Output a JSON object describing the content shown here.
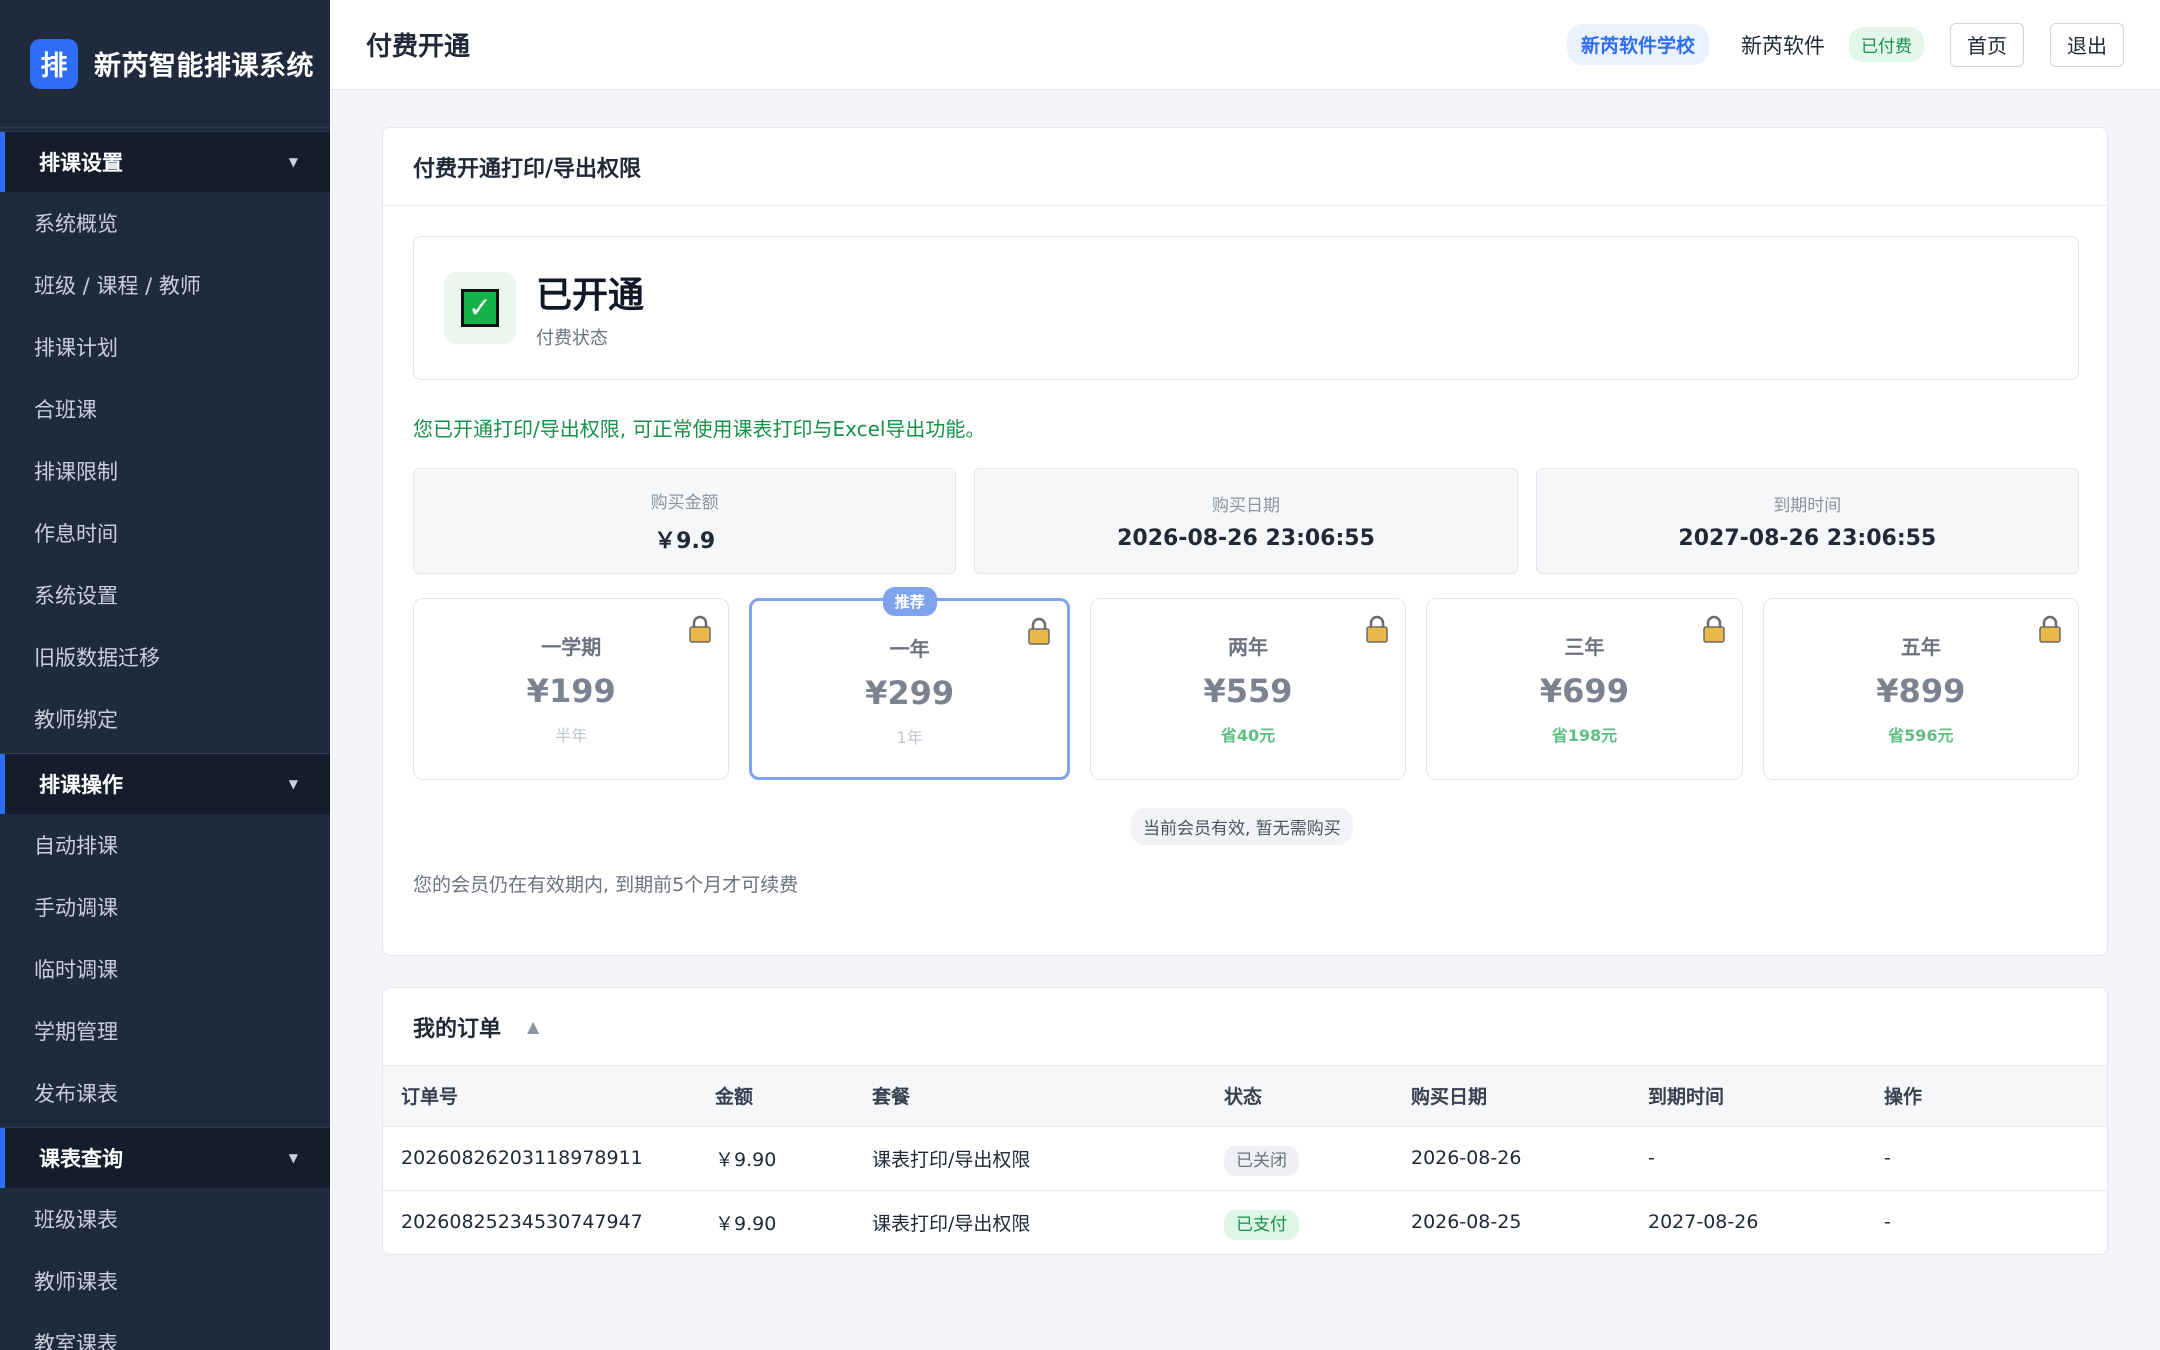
{
  "brand": {
    "logo_char": "排",
    "name": "新芮智能排课系统"
  },
  "sidebar": {
    "groups": [
      {
        "title": "排课设置",
        "items": [
          "系统概览",
          "班级 / 课程 / 教师",
          "排课计划",
          "合班课",
          "排课限制",
          "作息时间",
          "系统设置",
          "旧版数据迁移",
          "教师绑定"
        ]
      },
      {
        "title": "排课操作",
        "items": [
          "自动排课",
          "手动调课",
          "临时调课",
          "学期管理",
          "发布课表"
        ]
      },
      {
        "title": "课表查询",
        "items": [
          "班级课表",
          "教师课表",
          "教室课表"
        ]
      }
    ],
    "caret": "▼"
  },
  "header": {
    "title": "付费开通",
    "school": "新芮软件学校",
    "user": "新芮软件",
    "paid_badge": "已付费",
    "home_btn": "首页",
    "logout_btn": "退出"
  },
  "payment": {
    "card_title": "付费开通打印/导出权限",
    "status_main": "已开通",
    "status_sub": "付费状态",
    "status_check": "✓",
    "notice": "您已开通打印/导出权限, 可正常使用课表打印与Excel导出功能。",
    "info": [
      {
        "label": "购买金额",
        "value": "￥9.9"
      },
      {
        "label": "购买日期",
        "value": "2026-08-26 23:06:55"
      },
      {
        "label": "到期时间",
        "value": "2027-08-26 23:06:55"
      }
    ],
    "plans": [
      {
        "name": "一学期",
        "price": "¥199",
        "note": "半年",
        "save": false,
        "featured": false
      },
      {
        "name": "一年",
        "price": "¥299",
        "note": "1年",
        "save": false,
        "featured": true,
        "badge": "推荐"
      },
      {
        "name": "两年",
        "price": "¥559",
        "note": "省40元",
        "save": true,
        "featured": false
      },
      {
        "name": "三年",
        "price": "¥699",
        "note": "省198元",
        "save": true,
        "featured": false
      },
      {
        "name": "五年",
        "price": "¥899",
        "note": "省596元",
        "save": true,
        "featured": false
      }
    ],
    "hint": "当前会员有效, 暂无需购买",
    "renew_note": "您的会员仍在有效期内, 到期前5个月才可续费"
  },
  "orders": {
    "title": "我的订单",
    "toggle": "▲",
    "columns": [
      "订单号",
      "金额",
      "套餐",
      "状态",
      "购买日期",
      "到期时间",
      "操作"
    ],
    "rows": [
      {
        "id": "20260826203118978911",
        "amount": "￥9.90",
        "package": "课表打印/导出权限",
        "status": "已关闭",
        "status_type": "closed",
        "date": "2026-08-26",
        "expire": "-",
        "action": "-"
      },
      {
        "id": "20260825234530747947",
        "amount": "￥9.90",
        "package": "课表打印/导出权限",
        "status": "已支付",
        "status_type": "paid",
        "date": "2026-08-25",
        "expire": "2027-08-26",
        "action": "-"
      }
    ]
  },
  "colors": {
    "accent": "#2f6df6",
    "success": "#17914a",
    "sidebar_bg": "#1f2a3d"
  }
}
